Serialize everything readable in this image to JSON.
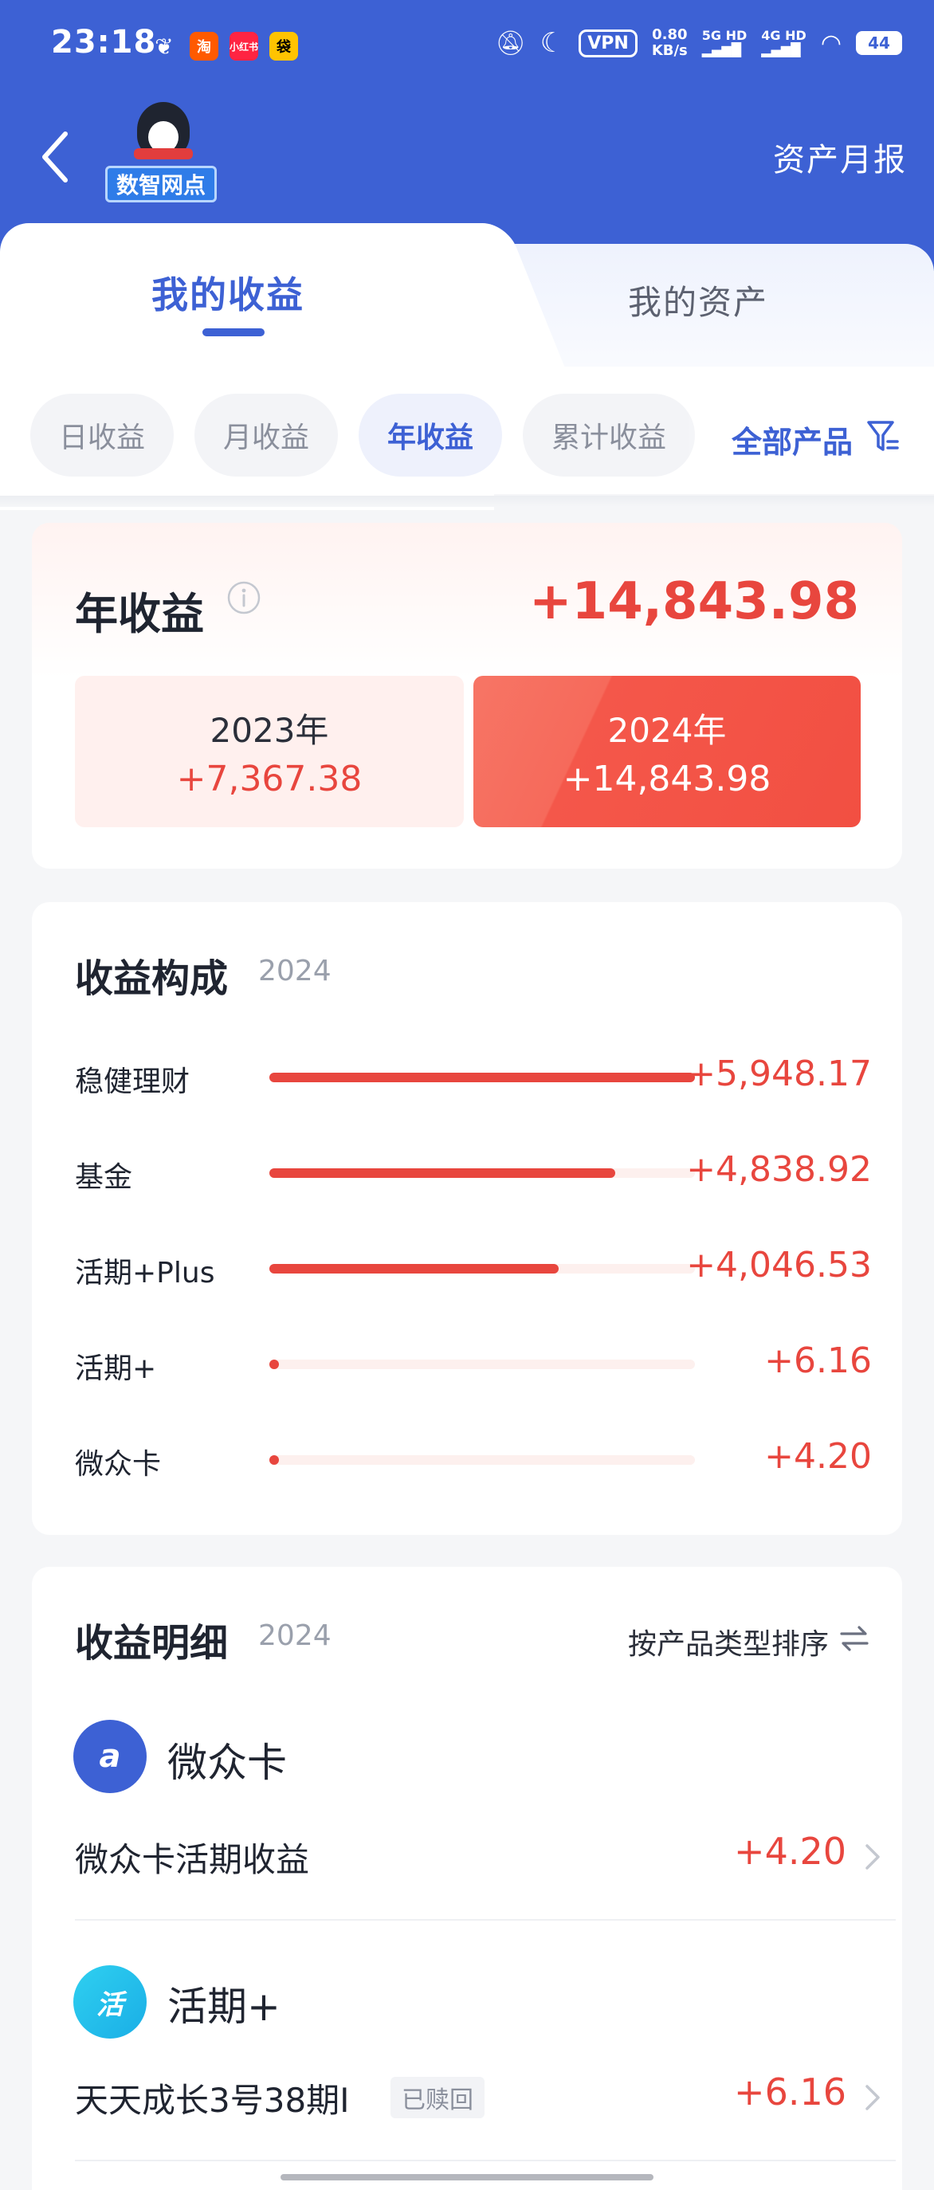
{
  "status_bar": {
    "time": "23:18",
    "net_speed_value": "0.80",
    "net_speed_unit": "KB/s",
    "vpn": "VPN",
    "signal_1": "5G HD",
    "signal_2": "4G HD",
    "battery": "44"
  },
  "header": {
    "logo_text": "数智网点",
    "report_link": "资产月报"
  },
  "main_tabs": [
    {
      "label": "我的收益",
      "active": true
    },
    {
      "label": "我的资产",
      "active": false
    }
  ],
  "sub_tabs": [
    {
      "label": "日收益",
      "active": false
    },
    {
      "label": "月收益",
      "active": false
    },
    {
      "label": "年收益",
      "active": true
    },
    {
      "label": "累计收益",
      "active": false
    }
  ],
  "filter": {
    "label": "全部产品"
  },
  "year_summary": {
    "title": "年收益",
    "total": "+14,843.98",
    "years": [
      {
        "year": "2023年",
        "value": "+7,367.38",
        "selected": false
      },
      {
        "year": "2024年",
        "value": "+14,843.98",
        "selected": true
      }
    ]
  },
  "composition": {
    "title": "收益构成",
    "year": "2024",
    "items": [
      {
        "label": "稳健理财",
        "value": "+5,948.17",
        "amount": 5948.17
      },
      {
        "label": "基金",
        "value": "+4,838.92",
        "amount": 4838.92
      },
      {
        "label": "活期+Plus",
        "value": "+4,046.53",
        "amount": 4046.53
      },
      {
        "label": "活期+",
        "value": "+6.16",
        "amount": 6.16
      },
      {
        "label": "微众卡",
        "value": "+4.20",
        "amount": 4.2
      }
    ]
  },
  "details": {
    "title": "收益明细",
    "year": "2024",
    "sort_label": "按产品类型排序",
    "groups": [
      {
        "name": "微众卡",
        "icon_glyph": "a",
        "items": [
          {
            "name": "微众卡活期收益",
            "badge": "",
            "value": "+4.20"
          }
        ]
      },
      {
        "name": "活期+",
        "icon_glyph": "活",
        "items": [
          {
            "name": "天天成长3号38期I",
            "badge": "已赎回",
            "value": "+6.16"
          }
        ]
      }
    ]
  },
  "colors": {
    "brand_blue": "#3d61d4",
    "positive_red": "#e8463e"
  }
}
